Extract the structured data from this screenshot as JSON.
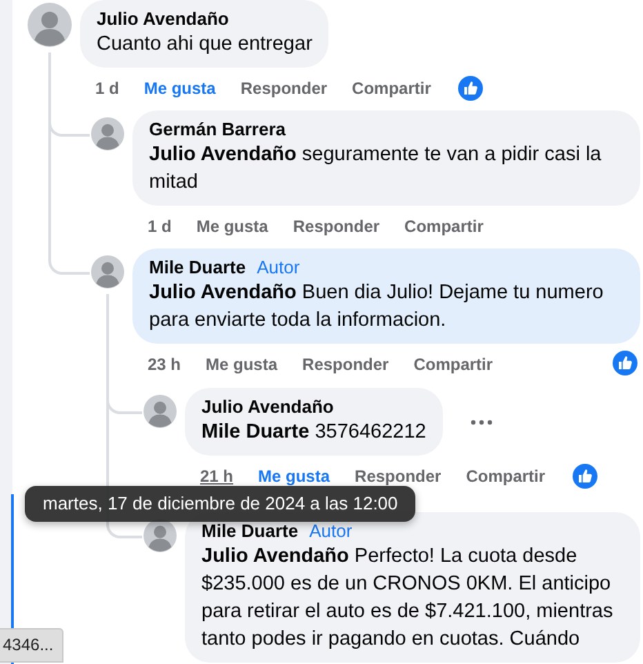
{
  "comments": [
    {
      "author": "Julio Avendaño",
      "text": "Cuanto ahi que entregar",
      "highlighted": false,
      "menu_button": false,
      "time": "1 d",
      "time_underlined": false,
      "like_label": "Me gusta",
      "liked": true,
      "reply_label": "Responder",
      "share_label": "Compartir",
      "reacted": true,
      "children": [
        {
          "author": "Germán Barrera",
          "text": "**Julio Avendaño** seguramente te van a pidir casi la mitad",
          "highlighted": false,
          "menu_button": false,
          "time": "1 d",
          "time_underlined": false,
          "like_label": "Me gusta",
          "liked": false,
          "reply_label": "Responder",
          "share_label": "Compartir",
          "reacted": false
        },
        {
          "author": "Mile Duarte",
          "badge": "Autor",
          "text": "**Julio Avendaño** Buen dia Julio! Dejame tu numero para enviarte toda la informacion.",
          "highlighted": true,
          "menu_button": false,
          "time": "23 h",
          "time_underlined": false,
          "like_label": "Me gusta",
          "liked": false,
          "reply_label": "Responder",
          "share_label": "Compartir",
          "reacted": true,
          "children": [
            {
              "author": "Julio Avendaño",
              "text": "**Mile Duarte** 3576462212",
              "highlighted": false,
              "menu_button": true,
              "time": "21 h",
              "time_underlined": true,
              "like_label": "Me gusta",
              "liked": true,
              "reply_label": "Responder",
              "share_label": "Compartir",
              "reacted": true
            },
            {
              "author": "Mile Duarte",
              "badge": "Autor",
              "text": "**Julio Avendaño** Perfecto! La cuota desde $235.000 es de un CRONOS 0KM. El anticipo para retirar el auto es de $7.421.100, mientras tanto podes ir pagando en cuotas. Cuándo",
              "highlighted": false,
              "menu_button": false
            }
          ]
        }
      ]
    }
  ],
  "tooltip": {
    "text": "martes, 17 de diciembre de 2024 a las 12:00"
  },
  "status_bar": {
    "text": "4346..."
  }
}
